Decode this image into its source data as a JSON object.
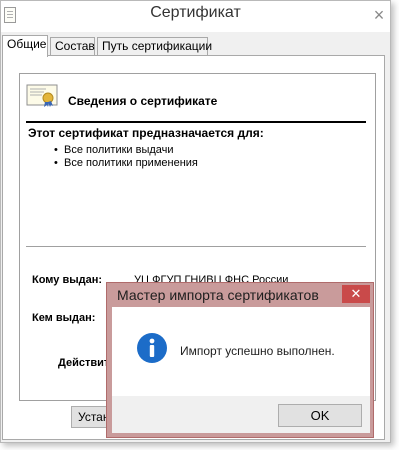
{
  "window": {
    "title": "Сертификат",
    "close_glyph": "×"
  },
  "tabs": [
    {
      "label": "Общие",
      "active": true
    },
    {
      "label": "Состав",
      "active": false
    },
    {
      "label": "Путь сертификации",
      "active": false
    }
  ],
  "cert": {
    "icon": "certificate-icon",
    "heading": "Сведения о сертификате",
    "purpose_heading": "Этот сертификат предназначается для:",
    "purposes": [
      "Все политики выдачи",
      "Все политики применения"
    ],
    "issued_to_label": "Кому выдан:",
    "issued_to_value": "УЦ ФГУП ГНИВЦ ФНС России",
    "issued_by_label": "Кем выдан:",
    "validity_label": "Действит"
  },
  "buttons": {
    "install_label": "Устан"
  },
  "dialog": {
    "title": "Мастер импорта сертификатов",
    "close_glyph": "✕",
    "icon": "info-icon",
    "message": "Импорт успешно выполнен.",
    "ok_label": "OK",
    "accent_color": "#c94a4a",
    "frame_color": "#c99b9b",
    "info_icon_color": "#1c6cc8"
  }
}
